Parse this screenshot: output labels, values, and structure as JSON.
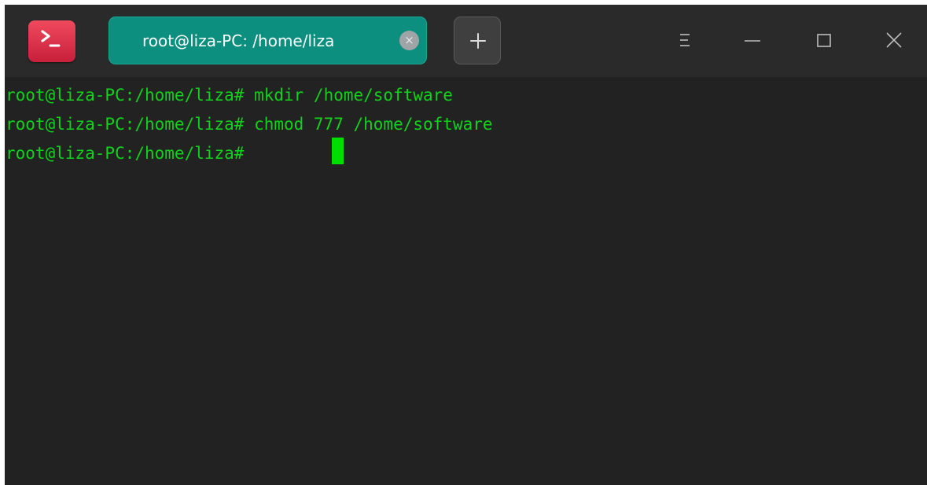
{
  "window": {
    "app_icon": "terminal-icon",
    "tab": {
      "title": "root@liza-PC: /home/liza",
      "close_label": "×",
      "close_icon": "close-circle-icon"
    },
    "new_tab_icon": "plus-icon",
    "controls": {
      "menu_icon": "hamburger-menu-icon",
      "minimize_icon": "minimize-icon",
      "maximize_icon": "maximize-icon",
      "close_icon": "close-icon"
    }
  },
  "terminal": {
    "lines": [
      "root@liza-PC:/home/liza# mkdir /home/software",
      "root@liza-PC:/home/liza# chmod 777 /home/software",
      "root@liza-PC:/home/liza# "
    ]
  },
  "colors": {
    "background": "#222222",
    "titlebar": "#2a2a2a",
    "tab_active": "#0c8f7e",
    "terminal_text": "#11d11c",
    "cursor": "#00e000",
    "app_icon": "#e0344d"
  }
}
